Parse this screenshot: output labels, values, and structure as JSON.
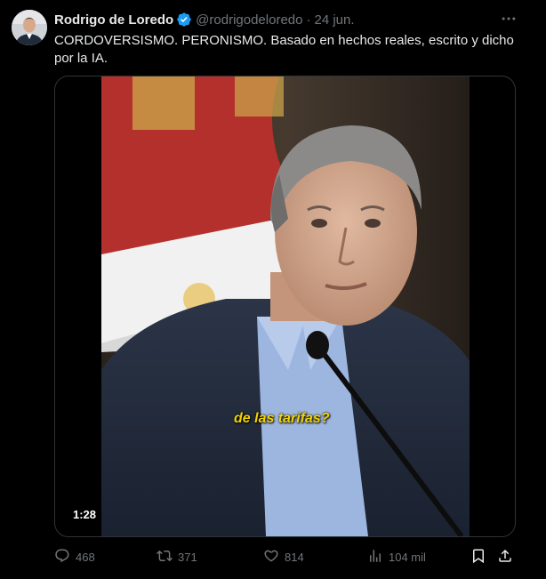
{
  "author": {
    "name": "Rodrigo de Loredo",
    "handle": "@rodrigodeloredo",
    "date": "24 jun.",
    "verified": true
  },
  "tweet_text": "CORDOVERSISMO. PERONISMO. Basado en hechos reales, escrito y dicho por la IA.",
  "media": {
    "caption": "de las tarifas?",
    "duration": "1:28"
  },
  "actions": {
    "replies": "468",
    "retweets": "371",
    "likes": "814",
    "views": "104 mil"
  },
  "icons": [
    "more-icon",
    "verified-icon",
    "reply-icon",
    "retweet-icon",
    "like-icon",
    "views-icon",
    "bookmark-icon",
    "share-icon"
  ],
  "colors": {
    "background": "#000000",
    "text": "#e7e9ea",
    "muted": "#71767b",
    "verified": "#1d9bf0",
    "caption": "#f2d300"
  }
}
